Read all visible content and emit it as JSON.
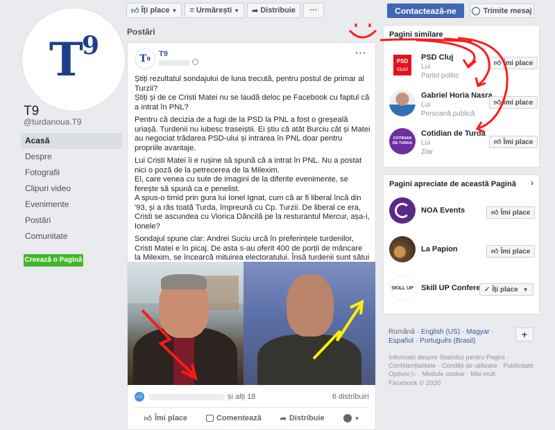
{
  "page": {
    "logo_text": "T9",
    "title": "T9",
    "handle": "@turdanoua.T9"
  },
  "nav": {
    "items": [
      "Acasă",
      "Despre",
      "Fotografii",
      "Clipuri video",
      "Evenimente",
      "Postări",
      "Comunitate"
    ],
    "active_index": 0,
    "create_button": "Creează o Pagină"
  },
  "toolbar": {
    "like": "Îți place",
    "follow": "Urmărești",
    "share": "Distribuie",
    "more": "···",
    "contact": "Contactează-ne",
    "message": "Trimite mesaj"
  },
  "posts_heading": "Postări",
  "post": {
    "author": "T9",
    "paragraphs": [
      "Știți rezultatul sondajului de luna trecută, pentru postul de primar al Turzii?\nȘtiți și de ce Cristi Matei nu se laudă deloc pe Facebook cu faptul că a intrat în PNL?",
      "Pentru că decizia de a fugi de la PSD la PNL a fost o greșeală uriașă. Turdenii nu iubesc traseiștii. Ei știu că atât Burciu cât și Matei au negociat trădarea PSD-ului și intrarea în PNL doar pentru propriile avantaje.",
      "Lui Cristi Matei îi e rușine să spună că a intrat în PNL. Nu a postat nici o poză de la petrecerea de la Milexim.\nEl, care venea cu sute de imagini de la diferite evenimente, se ferește să spună ca e penelist.\nA spus-o timid prin gura lui Ionel Ignat, cum că ar fi liberal încă din '93, și a râs toată Turda, împreună cu Cp. Turzii. De liberal ce era, Cristi se ascundea cu Viorica Dăncilă pe la resturantul Mercur, așa-i, Ionele?",
      "Sondajul spune clar: Andrei Suciu urcă în preferințele turdenilor, Cristi Matei e în picaj. De asta s-au oferit 400 de porții de mâncare la Milexim, se încearcă mituirea electoratului. Însă turdenii sunt sătui de minciuni."
    ],
    "reactions_others": "și alți 18",
    "shares": "6 distribuiri",
    "actions": [
      "Îmi place",
      "Comentează",
      "Distribuie"
    ]
  },
  "related": {
    "title": "Pagini similare",
    "items": [
      {
        "name": "PSD Cluj",
        "sub1": "Lui",
        "sub2": "Partid politic",
        "button": "Îmi place",
        "thumb_label": "PSD",
        "thumb_sub": "CLUJ",
        "color": "#e4131b"
      },
      {
        "name": "Gabriel Horia Nasra",
        "sub1": "Lui",
        "sub2": "Persoană publică",
        "button": "Îmi place",
        "color": "#2e6fb7"
      },
      {
        "name": "Cotidian de Turda",
        "sub1": "Lui",
        "sub2": "Ziar",
        "button": "Îmi place",
        "thumb_label": "COTIDIAN DE TURDA",
        "color": "#6d2fa0"
      }
    ]
  },
  "liked": {
    "title": "Pagini apreciate de această Pagină",
    "items": [
      {
        "name": "NOA Events",
        "button": "Îmi place",
        "color": "#5a2a86"
      },
      {
        "name": "La Papion",
        "button": "Îmi place",
        "color": "#8a5a2b"
      },
      {
        "name": "Skill UP Confere...",
        "button": "Îți place",
        "thumb_label": "SKILL UP",
        "color": "#ffffff"
      }
    ]
  },
  "languages": [
    "Română",
    "English (US)",
    "Magyar",
    "Español",
    "Português (Brasil)"
  ],
  "footer": {
    "links": "Informații despre Statistici pentru Pagini · Confidențialitate · Condiții de utilizare · Publicitate · Opțiuni ▷ · Module cookie · Mai mult ·",
    "copyright": "Facebook © 2020"
  },
  "colors": {
    "brand_blue": "#4267b2",
    "link_blue": "#385898",
    "green": "#42b72a",
    "annotation_red": "#ff1a1a",
    "annotation_yellow": "#ffee00"
  }
}
